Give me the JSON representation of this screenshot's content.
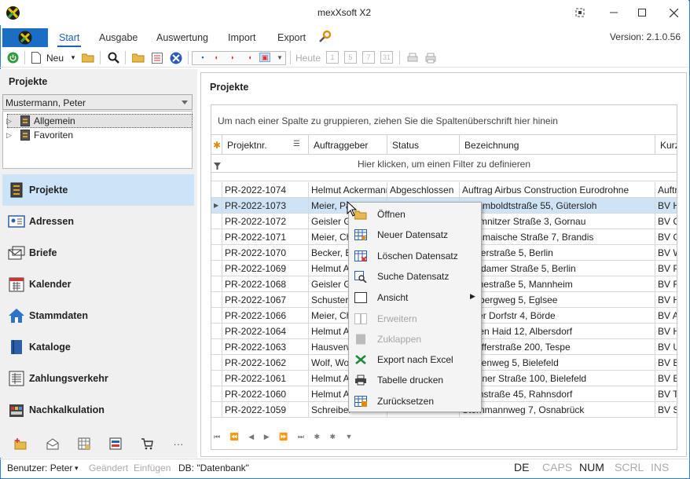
{
  "window": {
    "title": "mexXsoft X2"
  },
  "ribbon": {
    "tabs": [
      {
        "label": "Start"
      },
      {
        "label": "Ausgabe"
      },
      {
        "label": "Auswertung"
      },
      {
        "label": "Import"
      },
      {
        "label": "Export"
      }
    ],
    "version": "Version: 2.1.0.56"
  },
  "toolbar": {
    "new_label": "Neu",
    "today_label": "Heute",
    "calendar_buttons": [
      "1",
      "5",
      "7",
      "31"
    ]
  },
  "left": {
    "section_title": "Projekte",
    "user": "Mustermann, Peter",
    "tree": [
      {
        "label": "Allgemein"
      },
      {
        "label": "Favoriten"
      }
    ],
    "nav": [
      {
        "label": "Projekte",
        "icon": "projects-icon"
      },
      {
        "label": "Adressen",
        "icon": "addresses-icon"
      },
      {
        "label": "Briefe",
        "icon": "letters-icon"
      },
      {
        "label": "Kalender",
        "icon": "calendar-icon"
      },
      {
        "label": "Stammdaten",
        "icon": "home-icon"
      },
      {
        "label": "Kataloge",
        "icon": "catalog-icon"
      },
      {
        "label": "Zahlungsverkehr",
        "icon": "payments-icon"
      },
      {
        "label": "Nachkalkulation",
        "icon": "calculation-icon"
      }
    ],
    "bottom_more": "···"
  },
  "main": {
    "title": "Projekte",
    "group_hint": "Um nach einer Spalte zu gruppieren, ziehen Sie die Spaltenüberschrift hier hinein",
    "columns": [
      "Projektnr.",
      "Auftraggeber",
      "Status",
      "Bezeichnung",
      "Kurz"
    ],
    "filter_hint": "Hier klicken, um einen Filter zu definieren",
    "rows": [
      [
        "PR-2022-1074",
        "Helmut Ackermann",
        "Abgeschlossen",
        "Auftrag Airbus Construction Eurodrohne",
        "Auftr"
      ],
      [
        "PR-2022-1073",
        "Meier, Pa",
        "",
        "A Humboldtstraße 55, Gütersloh",
        "BV H"
      ],
      [
        "PR-2022-1072",
        "Geisler Gr",
        "",
        "Chemnitzer Straße 3, Gornau",
        "BV C"
      ],
      [
        "PR-2022-1071",
        "Meier, Ch",
        "",
        "Grimmaische Straße 7, Brandis",
        "BV G"
      ],
      [
        "PR-2022-1070",
        "Becker, B",
        "",
        "Weserstraße 5, Berlin",
        "BV W"
      ],
      [
        "PR-2022-1069",
        "Helmut A",
        "",
        "Potsdamer Straße 5, Berlin",
        "BV P"
      ],
      [
        "PR-2022-1068",
        "Geisler Gr",
        "",
        "Steinestraße 5, Mannheim",
        "BV R"
      ],
      [
        "PR-2022-1067",
        "Schuster,",
        "",
        "Neubergweg 5, Eglsee",
        "BV H"
      ],
      [
        "PR-2022-1066",
        "Meier, Ch",
        "",
        "In der Dorfstr 4, Börde",
        "BV A"
      ],
      [
        "PR-2022-1064",
        "Helmut A",
        "",
        "Bogen Haid 12, Albersdorf",
        "BV H"
      ],
      [
        "PR-2022-1063",
        "Hausverw",
        "",
        "Ulbufferstraße 200, Tespe",
        "BV U"
      ],
      [
        "PR-2022-1062",
        "Wolf, Wo",
        "",
        "Emdenweg 5, Bielefeld",
        "BV E"
      ],
      [
        "PR-2022-1061",
        "Helmut A",
        "",
        "Brenner Straße 100, Bielefeld",
        "BV B"
      ],
      [
        "PR-2022-1060",
        "Helmut A",
        "",
        "Turmstraße 45, Rahnsdorf",
        "BV T"
      ],
      [
        "PR-2022-1059",
        "Schreiber",
        "",
        "Sternmannweg 7, Osnabrück",
        "BV S"
      ]
    ]
  },
  "context_menu": [
    {
      "label": "Öffnen",
      "icon": "folder-open-icon",
      "enabled": true
    },
    {
      "label": "Neuer Datensatz",
      "icon": "new-record-icon",
      "enabled": true
    },
    {
      "label": "Löschen Datensatz",
      "icon": "delete-record-icon",
      "enabled": true
    },
    {
      "label": "Suche Datensatz",
      "icon": "search-record-icon",
      "enabled": true
    },
    {
      "label": "Ansicht",
      "icon": "view-icon",
      "enabled": true
    },
    {
      "label": "Erweitern",
      "icon": "expand-icon",
      "enabled": false
    },
    {
      "label": "Zuklappen",
      "icon": "collapse-icon",
      "enabled": false
    },
    {
      "label": "Export nach Excel",
      "icon": "excel-icon",
      "enabled": true
    },
    {
      "label": "Tabelle drucken",
      "icon": "print-icon",
      "enabled": true
    },
    {
      "label": "Zurücksetzen",
      "icon": "reset-icon",
      "enabled": true
    }
  ],
  "status": {
    "user": "Benutzer: Peter",
    "changed": "Geändert",
    "inserted": "Einfügen",
    "db": "DB: \"Datenbank\"",
    "lang": "DE",
    "caps": "CAPS",
    "num": "NUM",
    "scrl": "SCRL",
    "ins": "INS"
  },
  "colors": {
    "accent": "#1c6dc4",
    "selection": "#cce4f7",
    "row_selected": "#cfe3f6"
  }
}
